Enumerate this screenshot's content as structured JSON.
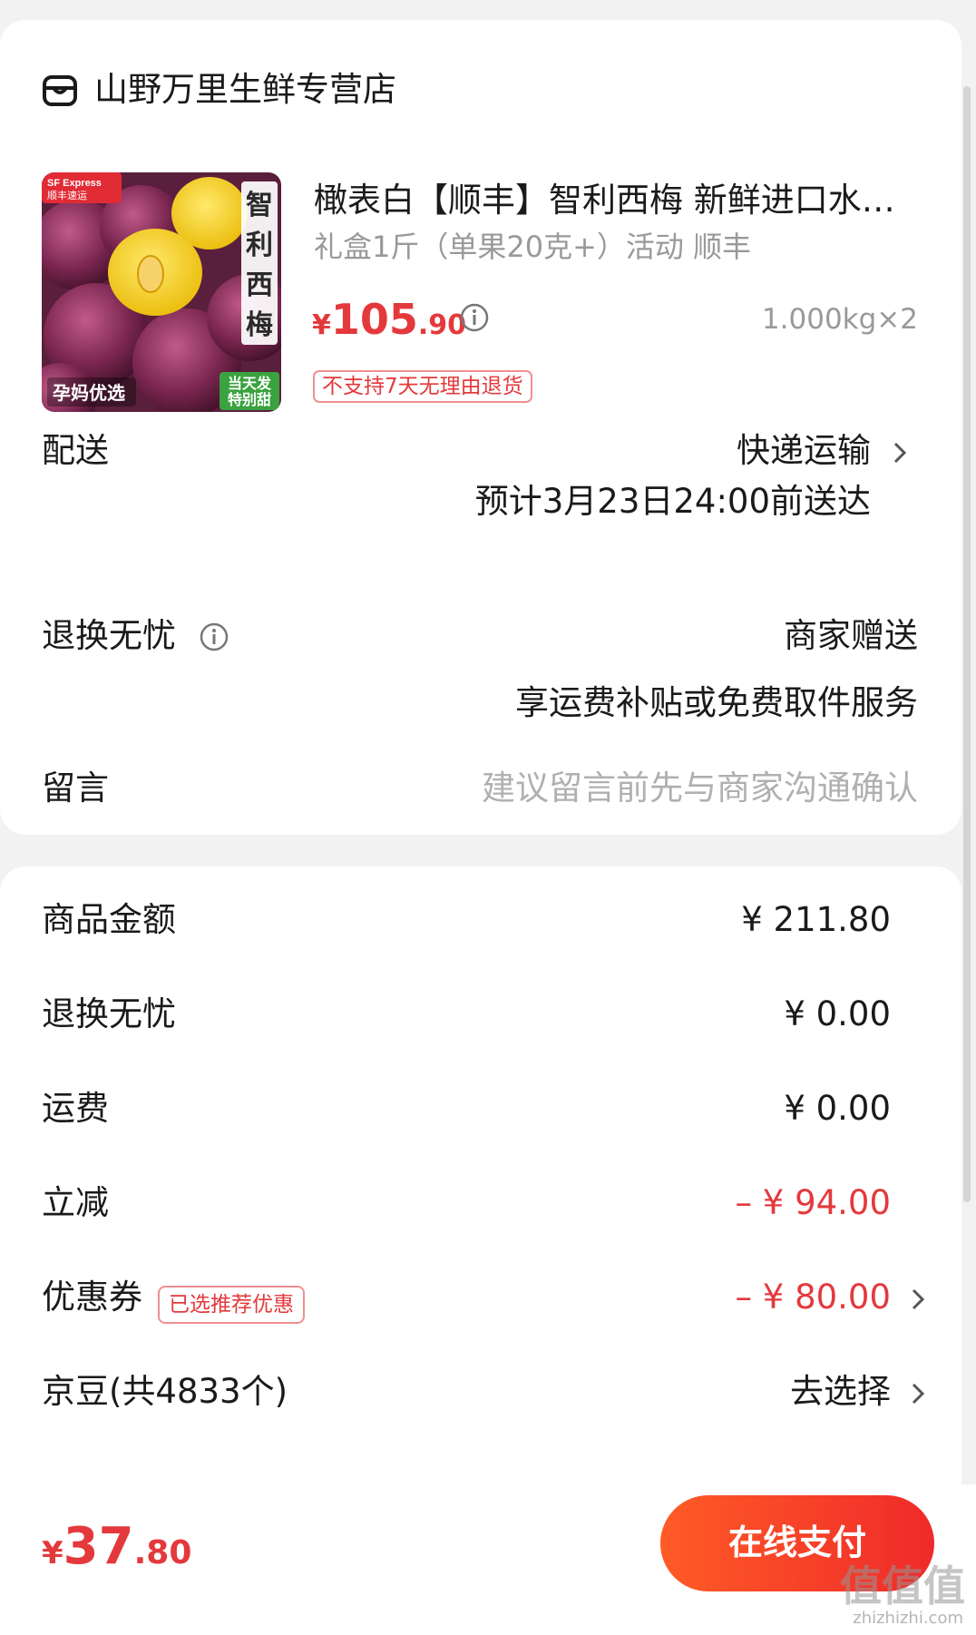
{
  "shop": {
    "name": "山野万里生鲜专营店"
  },
  "product": {
    "title": "橄表白【顺丰】智利西梅 新鲜进口水…",
    "spec": "礼盒1斤（单果20克+）活动 顺丰",
    "price_symbol": "¥",
    "price_int": "105",
    "price_dec": ".90",
    "quantity": "1.000kg×2",
    "return_tag": "不支持7天无理由退货",
    "image_texts": {
      "sf_badge": "SF Express 顺丰速运",
      "vertical_title": "智利西梅",
      "left_tag": "孕妈优选",
      "right_tag_1": "当天发",
      "right_tag_2": "特别甜"
    }
  },
  "delivery": {
    "label": "配送",
    "method": "快递运输",
    "eta": "预计3月23日24:00前送达"
  },
  "returns": {
    "label": "退换无忧",
    "value": "商家赠送",
    "desc": "享运费补贴或免费取件服务"
  },
  "message": {
    "label": "留言",
    "placeholder": "建议留言前先与商家沟通确认"
  },
  "summary": {
    "rows": [
      {
        "label": "商品金额",
        "value": "¥ 211.80"
      },
      {
        "label": "退换无忧",
        "value": "¥ 0.00"
      },
      {
        "label": "运费",
        "value": "¥ 0.00"
      },
      {
        "label": "立减",
        "value": "– ¥ 94.00"
      },
      {
        "label": "优惠券",
        "value": "– ¥ 80.00"
      },
      {
        "label": "京豆(共4833个)",
        "value": "去选择"
      }
    ],
    "coupon_tag": "已选推荐优惠"
  },
  "footer": {
    "total_symbol": "¥",
    "total_int": "37",
    "total_dec": ".80",
    "pay_button": "在线支付",
    "watermark": "值值值",
    "watermark_url": "zhizhizhi.com"
  },
  "colors": {
    "accent": "#e4393c",
    "pay_gradient_start": "#ff5b26",
    "pay_gradient_end": "#ef2a2a"
  }
}
